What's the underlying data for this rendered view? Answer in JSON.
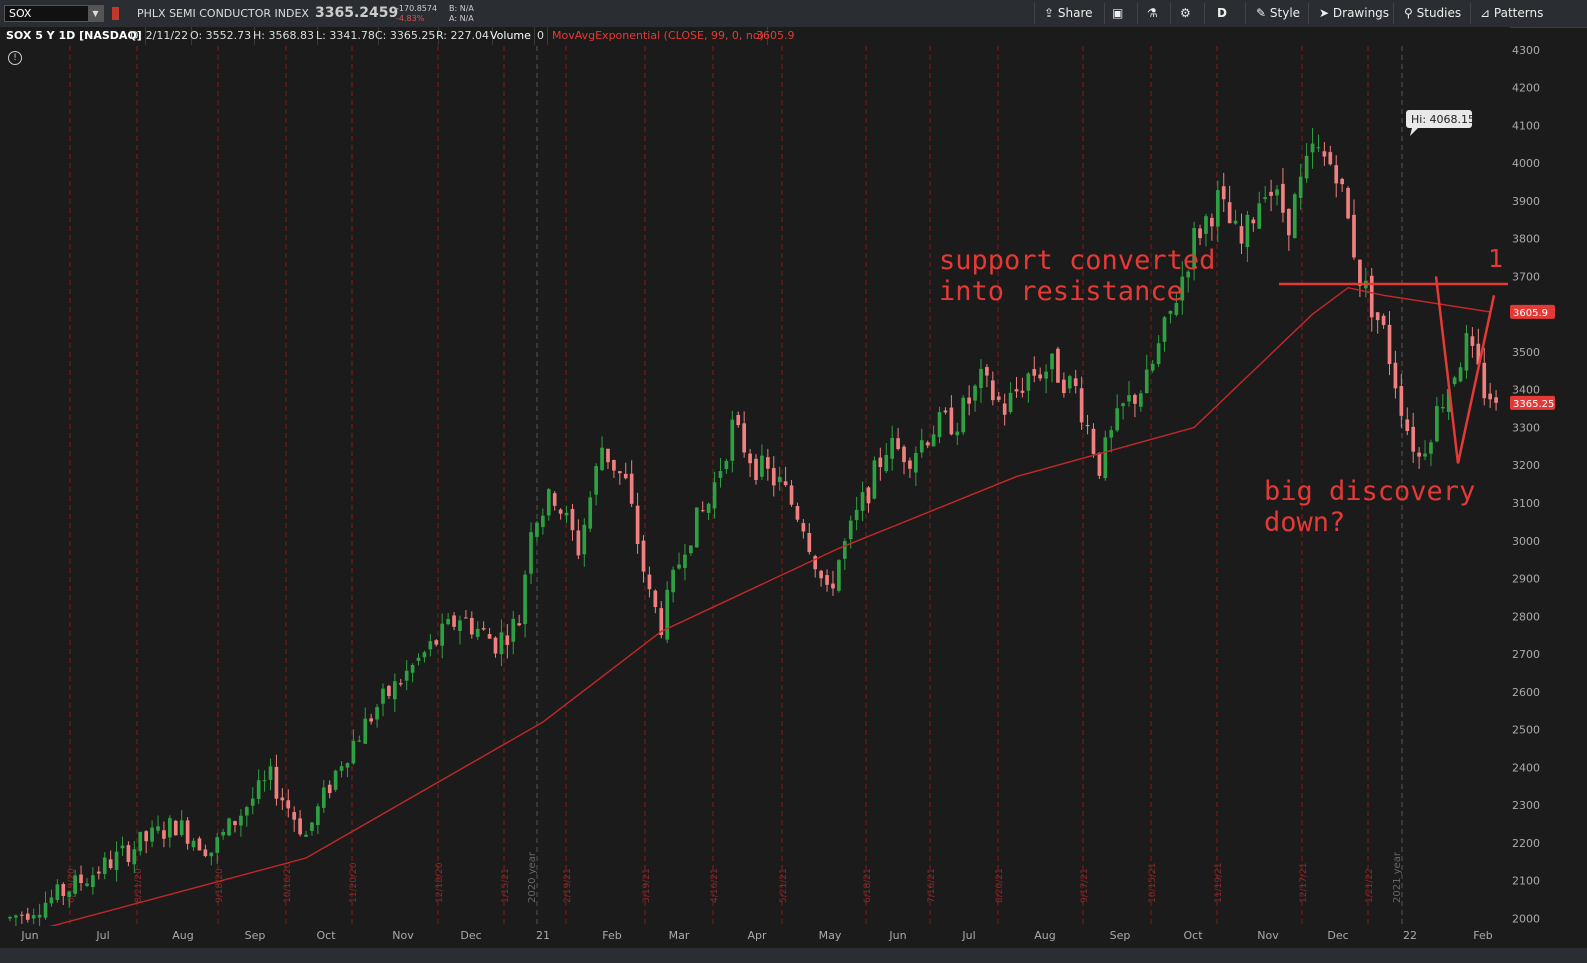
{
  "toolbar": {
    "symbol": "SOX",
    "index_name": "PHLX SEMI CONDUCTOR INDEX",
    "last_price": "3365.2459",
    "change_abs": "-170.8574",
    "change_pct": "-4.83%",
    "bid": "B: N/A",
    "ask": "A: N/A",
    "share_label": "Share",
    "aggregation_label": "D",
    "style_label": "Style",
    "drawings_label": "Drawings",
    "studies_label": "Studies",
    "patterns_label": "Patterns",
    "icons": [
      "share-icon",
      "screenshot-icon",
      "flask-icon",
      "gear-icon",
      "style-icon",
      "cursor-icon",
      "studies-icon",
      "patterns-icon"
    ]
  },
  "infobar": {
    "chart_label": "SOX 5 Y 1D [NASDAQ]",
    "date": "D: 2/11/22",
    "open": "O: 3552.73",
    "high": "H: 3568.83",
    "low": "L: 3341.78",
    "close": "C: 3365.25",
    "range": "R: 227.04",
    "volume_label": "Volume",
    "volume_value": "0",
    "study_label": "MovAvgExponential (CLOSE, 99, 0, no)",
    "study_value": "3605.9"
  },
  "chart_data": {
    "type": "candlestick",
    "ylim": [
      1980,
      4310
    ],
    "y_ticks": [
      2000,
      2100,
      2200,
      2300,
      2400,
      2500,
      2600,
      2700,
      2800,
      2900,
      3000,
      3100,
      3200,
      3300,
      3400,
      3500,
      3600,
      3700,
      3800,
      3900,
      4000,
      4100,
      4200,
      4300
    ],
    "x_labels": [
      "Jun",
      "Jul",
      "Aug",
      "Sep",
      "Oct",
      "Nov",
      "Dec",
      "21",
      "Feb",
      "Mar",
      "Apr",
      "May",
      "Jun",
      "Jul",
      "Aug",
      "Sep",
      "Oct",
      "Nov",
      "Dec",
      "22",
      "Feb"
    ],
    "year_separators": [
      "2020 year",
      "2021 year"
    ],
    "expiration_labels": [
      "6/19/20",
      "8/21/20",
      "9/18/20",
      "10/16/20",
      "11/20/20",
      "12/18/20",
      "1/15/21",
      "2/19/21",
      "3/19/21",
      "4/16/21",
      "5/21/21",
      "6/18/21",
      "7/16/21",
      "8/20/21",
      "9/17/21",
      "10/15/21",
      "11/19/21",
      "12/17/21",
      "1/21/22"
    ],
    "price_path": [
      [
        0,
        2000
      ],
      [
        8,
        2060
      ],
      [
        16,
        2140
      ],
      [
        22,
        2200
      ],
      [
        28,
        2250
      ],
      [
        34,
        2180
      ],
      [
        40,
        2300
      ],
      [
        44,
        2370
      ],
      [
        50,
        2220
      ],
      [
        56,
        2420
      ],
      [
        62,
        2560
      ],
      [
        70,
        2700
      ],
      [
        76,
        2800
      ],
      [
        82,
        2730
      ],
      [
        86,
        2790
      ],
      [
        88,
        3050
      ],
      [
        92,
        3120
      ],
      [
        96,
        2980
      ],
      [
        100,
        3250
      ],
      [
        104,
        3150
      ],
      [
        108,
        2850
      ],
      [
        110,
        2780
      ],
      [
        114,
        3000
      ],
      [
        118,
        3100
      ],
      [
        122,
        3300
      ],
      [
        126,
        3200
      ],
      [
        130,
        3150
      ],
      [
        134,
        3050
      ],
      [
        138,
        2850
      ],
      [
        140,
        2950
      ],
      [
        144,
        3100
      ],
      [
        148,
        3250
      ],
      [
        152,
        3230
      ],
      [
        156,
        3300
      ],
      [
        160,
        3320
      ],
      [
        164,
        3420
      ],
      [
        168,
        3350
      ],
      [
        172,
        3440
      ],
      [
        176,
        3460
      ],
      [
        180,
        3400
      ],
      [
        184,
        3200
      ],
      [
        188,
        3350
      ],
      [
        192,
        3420
      ],
      [
        196,
        3600
      ],
      [
        200,
        3800
      ],
      [
        204,
        3900
      ],
      [
        208,
        3780
      ],
      [
        212,
        3950
      ],
      [
        216,
        3850
      ],
      [
        220,
        4030
      ],
      [
        224,
        3990
      ],
      [
        228,
        3700
      ],
      [
        232,
        3550
      ],
      [
        236,
        3300
      ],
      [
        238,
        3220
      ],
      [
        242,
        3380
      ],
      [
        246,
        3520
      ],
      [
        249,
        3400
      ],
      [
        252,
        3365
      ]
    ],
    "candles_total": 252,
    "final_close": 3365.25,
    "series": [
      {
        "name": "MovAvgExponential (CLOSE, 99, 0, no)",
        "color": "#c62828",
        "path": [
          [
            0,
            1950
          ],
          [
            50,
            2160
          ],
          [
            90,
            2520
          ],
          [
            110,
            2760
          ],
          [
            140,
            2980
          ],
          [
            170,
            3170
          ],
          [
            200,
            3300
          ],
          [
            220,
            3600
          ],
          [
            226,
            3670
          ],
          [
            232,
            3650
          ],
          [
            250,
            3606
          ]
        ]
      }
    ],
    "price_labels": [
      {
        "text": "3605.9",
        "value": 3605.9,
        "color": "#e53935"
      },
      {
        "text": "3365.25",
        "value": 3365.25,
        "color": "#e53935"
      }
    ],
    "annotations": [
      {
        "text": "support converted",
        "color": "#e53935"
      },
      {
        "text": "into resistance",
        "color": "#e53935"
      },
      {
        "text": "1",
        "color": "#e53935"
      },
      {
        "text": "big discovery",
        "color": "#e53935"
      },
      {
        "text": "down?",
        "color": "#e53935"
      },
      {
        "text": "Hi: 4068.15",
        "color": "#ffffff"
      }
    ],
    "resistance_level": 3680,
    "colors": {
      "up": "#2ea043",
      "down": "#f08080",
      "grid": "#8b1a1a",
      "background": "#1b1b1b"
    }
  }
}
